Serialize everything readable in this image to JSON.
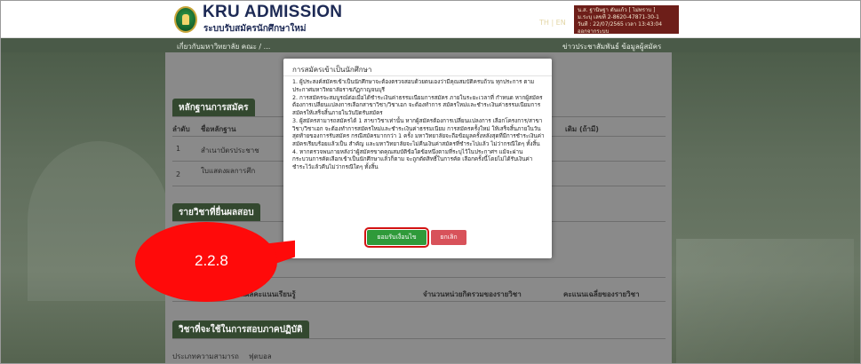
{
  "header": {
    "brand_title": "KRU ADMISSION",
    "brand_subtitle": "ระบบรับสมัครนักศึกษาใหม่",
    "lang": "TH | EN",
    "user": {
      "line1": "น.ส. ฐานิษฐา ตันแก้ว [ ไม่ทราบ ]",
      "line2": "ม.ระบุ เลขที่ 2-8620-47871-30-1",
      "line3": "วันที่ : 22/07/2565 เวลา 13:43:04",
      "line4": "ออกจากระบบ"
    }
  },
  "nav": {
    "left": "เกี่ยวกับมหาวิทยาลัย   คณะ / ...",
    "right": "ข่าวประชาสัมพันธ์   ข้อมูลผู้สมัคร"
  },
  "page": {
    "section1": "หลักฐานการสมัคร",
    "col_no": "ลำดับ",
    "col_doc": "ชื่อหลักฐาน",
    "col_right": "เดิม (ถ้ามี)",
    "row1_no": "1",
    "row1_doc": "สำเนาบัตรประชาช",
    "row2_no": "2",
    "row2_doc": "ใบแสดงผลการศึก",
    "section2": "รายวิชาที่ยื่นผลสอบ",
    "col_subject": "วิชาที่ยื่นผลคะแนนเรียนรู้",
    "col_credits": "จำนวนหน่วยกิตรวมของรายวิชา",
    "col_score": "คะแนนเฉลี่ยของรายวิชา",
    "section3": "วิชาที่จะใช้ในการสอบภาคปฏิบัติ",
    "row3a": "ประเภทความสามารถ",
    "row3b": "ฟุตบอล"
  },
  "modal": {
    "title": "การสมัครเข้าเป็นนักศึกษา",
    "items": [
      "1. ผู้ประสงค์สมัครเข้าเป็นนักศึกษาจะต้องตรวจสอบด้วยตนเองว่ามีคุณสมบัติครบถ้วน ทุกประการ ตามประกาศมหาวิทยาลัยราชภัฏกาญจนบุรี",
      "2. การสมัครจะสมบูรณ์ต่อเมื่อได้ชำระเงินค่าธรรมเนียมการสมัคร ภายในระยะเวลาที่ กำหนด หากผู้สมัครต้องการเปลี่ยนแปลงการเลือกสาขาวิชา/วิชาเอก จะต้องทำการ สมัครใหม่และชำระเงินค่าธรรมเนียมการสมัครให้เสร็จสิ้นภายในวันปิดรับสมัคร",
      "3. ผู้สมัครสามารถสมัครได้ 1 สาขาวิชาเท่านั้น หากผู้สมัครต้องการเปลี่ยนแปลงการ เลือกโครงการ/สาขาวิชา/วิชาเอก จะต้องทำการสมัครใหม่และชำระเงินค่าธรรมเนียม การสมัครครั้งใหม่ ให้เสร็จสิ้นภายในวันสุดท้ายของการรับสมัคร กรณีสมัครมากกว่า 1 ครั้ง มหาวิทยาลัยจะถือข้อมูลครั้งหลังสุดที่มีการชำระเงินค่าสมัครเรียบร้อยแล้วเป็น สำคัญ และมหาวิทยาลัยจะไม่คืนเงินค่าสมัครที่ชำระไปแล้ว ไม่ว่ากรณีใดๆ ทั้งสิ้น",
      "4. หากตรวจพบภายหลังว่าผู้สมัครขาดคุณสมบัติข้อใดข้อหนึ่งตามที่ระบุไว้ในประกาศฯ แม้จะผ่านกระบวนการคัดเลือกเข้าเป็นนักศึกษาแล้วก็ตาม จะถูกตัดสิทธิ์ในการคัด เลือกครั้งนี้โดยไม่ได้รับเงินค่าชำระไว้แล้วคืนไม่ว่ากรณีใดๆ ทั้งสิ้น"
    ],
    "ok_label": "ยอมรับเงื่อนไข",
    "cancel_label": "ยกเลิก"
  },
  "callout": {
    "text": "2.2.8",
    "color": "#ff0a0a"
  }
}
